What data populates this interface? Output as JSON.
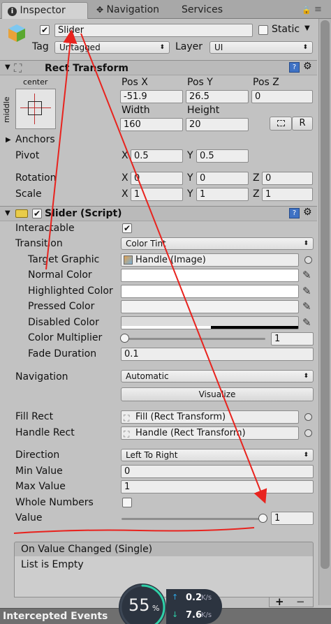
{
  "tabs": {
    "inspector": "Inspector",
    "navigation": "Navigation",
    "services": "Services"
  },
  "object": {
    "name": "Slider",
    "static_label": "Static",
    "tag_label": "Tag",
    "tag_value": "Untagged",
    "layer_label": "Layer",
    "layer_value": "UI"
  },
  "rect_transform": {
    "title": "Rect Transform",
    "anchor_h": "center",
    "anchor_v": "middle",
    "pos_x_label": "Pos X",
    "pos_y_label": "Pos Y",
    "pos_z_label": "Pos Z",
    "pos_x": "-51.9",
    "pos_y": "26.5",
    "pos_z": "0",
    "width_label": "Width",
    "height_label": "Height",
    "width": "160",
    "height": "20",
    "r_button": "R",
    "anchors_label": "Anchors",
    "pivot_label": "Pivot",
    "pivot_x": "0.5",
    "pivot_y": "0.5",
    "rotation_label": "Rotation",
    "rot_x": "0",
    "rot_y": "0",
    "rot_z": "0",
    "scale_label": "Scale",
    "scale_x": "1",
    "scale_y": "1",
    "scale_z": "1",
    "x": "X",
    "y": "Y",
    "z": "Z"
  },
  "slider_script": {
    "title": "Slider (Script)",
    "interactable_label": "Interactable",
    "transition_label": "Transition",
    "transition_value": "Color Tint",
    "target_graphic_label": "Target Graphic",
    "target_graphic_value": "Handle (Image)",
    "normal_color_label": "Normal Color",
    "highlighted_color_label": "Highlighted Color",
    "pressed_color_label": "Pressed Color",
    "disabled_color_label": "Disabled Color",
    "color_multiplier_label": "Color Multiplier",
    "color_multiplier_value": "1",
    "fade_duration_label": "Fade Duration",
    "fade_duration_value": "0.1",
    "navigation_label": "Navigation",
    "navigation_value": "Automatic",
    "visualize_button": "Visualize",
    "fill_rect_label": "Fill Rect",
    "fill_rect_value": "Fill (Rect Transform)",
    "handle_rect_label": "Handle Rect",
    "handle_rect_value": "Handle (Rect Transform)",
    "direction_label": "Direction",
    "direction_value": "Left To Right",
    "min_value_label": "Min Value",
    "min_value": "0",
    "max_value_label": "Max Value",
    "max_value": "1",
    "whole_numbers_label": "Whole Numbers",
    "value_label": "Value",
    "value": "1",
    "value_fraction": 1.0,
    "color_multiplier_fraction": 0.0
  },
  "event": {
    "title": "On Value Changed (Single)",
    "empty_text": "List is Empty",
    "add": "+",
    "remove": "−"
  },
  "footer": {
    "intercepted": "Intercepted Events"
  },
  "network_widget": {
    "percent": "55",
    "percent_sign": "%",
    "up_value": "0.2",
    "up_unit": "K/s",
    "down_value": "7.6",
    "down_unit": "K/s",
    "progress": 0.55
  },
  "colors": {
    "annotation_red": "#e8231e",
    "widget_ring": "#2fd0a8",
    "widget_bg": "#2c3440"
  }
}
